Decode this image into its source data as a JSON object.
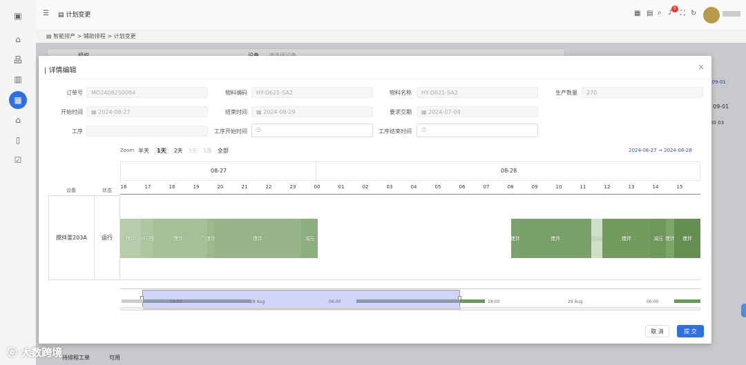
{
  "topbar": {
    "tab_title": "计划变更",
    "notification_count": "0"
  },
  "breadcrumb": [
    "智能排产",
    ">",
    "辅助排程",
    ">",
    "计划变更"
  ],
  "background": {
    "org_label": "组织",
    "device_label": "设备",
    "device_placeholder": "请选择设备",
    "right_date1": "-09-01",
    "right_date2": "09-01",
    "right_hours": "00  03",
    "bottom_tab1": "待排程工单",
    "bottom_tab2": "可用"
  },
  "modal": {
    "title": "详情编辑",
    "close": "×",
    "fields": {
      "order_no_label": "订单号",
      "order_no": "MO2408250084",
      "material_code_label": "物料编码",
      "material_code": "HY-D621-SA2",
      "material_name_label": "物料名称",
      "material_name": "HY-D621-SA2",
      "qty_label": "生产数量",
      "qty": "270",
      "start_label": "开始时间",
      "start": "2024-08-27",
      "end_label": "结束时间",
      "end": "2024-08-29",
      "due_label": "要求交期",
      "due": "2024-07-08",
      "process_label": "工序",
      "process": "",
      "proc_start_label": "工序开始时间",
      "proc_start": "",
      "proc_end_label": "工序结束时间",
      "proc_end": ""
    },
    "zoom": {
      "label": "Zoom",
      "options": [
        "半天",
        "1天",
        "2天",
        "3天",
        "1周",
        "全部"
      ],
      "active": "1天"
    },
    "range": {
      "from": "2024-08-27",
      "arrow": "→",
      "to": "2024-08-28"
    },
    "gantt": {
      "dates": [
        "08-27",
        "08-28"
      ],
      "hours": [
        "16",
        "17",
        "18",
        "19",
        "20",
        "21",
        "22",
        "23",
        "00",
        "01",
        "02",
        "03",
        "04",
        "05",
        "06",
        "07",
        "08",
        "09",
        "10",
        "11",
        "12",
        "13",
        "14",
        "15"
      ],
      "col_device": "设备",
      "col_status": "状态",
      "row": {
        "device": "搅拌釜203A",
        "status": "运行"
      },
      "tasks": [
        {
          "label": "搅拌",
          "color": "#b7cda9"
        },
        {
          "label": "一阶进料",
          "color": "#aec7a0"
        },
        {
          "label": "搅拌",
          "color": "#a4c096"
        },
        {
          "label": "一阶进料",
          "color": "#a4c096"
        },
        {
          "label": "搅拌",
          "color": "#9bba8c"
        },
        {
          "label": "搅拌",
          "color": "#97b588"
        },
        {
          "label": "减压",
          "color": "#8daf7e"
        },
        {
          "label": "搅拌",
          "color": "#7ea26d"
        },
        {
          "label": "搅拌",
          "color": "#79a068"
        },
        {
          "label": "三阶进料",
          "color": "#cfe0c4"
        },
        {
          "label": "搅拌",
          "color": "#739b60"
        },
        {
          "label": "减压",
          "color": "#6f975c"
        },
        {
          "label": "搅拌",
          "color": "#7ba569"
        },
        {
          "label": "搅拌",
          "color": "#648e52"
        }
      ],
      "navigator": [
        "18:00",
        "28 Aug",
        "06:00",
        "18:00",
        "29 Aug",
        "06:00"
      ]
    },
    "cancel": "取 消",
    "submit": "提 交"
  },
  "watermark": "大数跨境"
}
